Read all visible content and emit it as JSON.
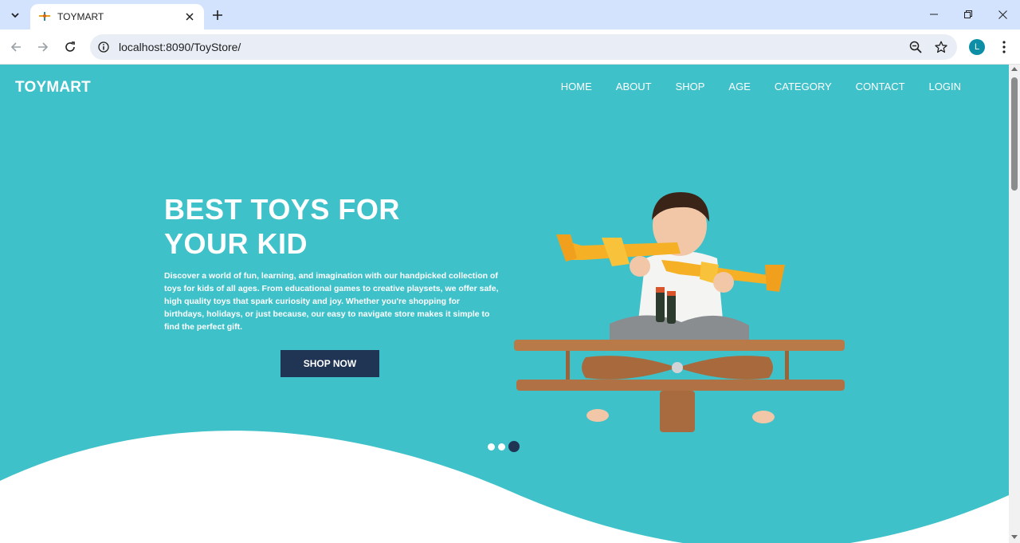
{
  "browser": {
    "tab_title": "TOYMART",
    "url": "localhost:8090/ToyStore/",
    "profile_initial": "L",
    "icons": {
      "tab_search": "chevron-down-icon",
      "favicon": "toy-plane-icon",
      "close_tab": "close-icon",
      "new_tab": "plus-icon",
      "back": "arrow-left-icon",
      "forward": "arrow-right-icon",
      "reload": "reload-icon",
      "site_info": "info-icon",
      "zoom": "zoom-icon",
      "bookmark": "star-icon",
      "menu": "kebab-icon",
      "minimize": "minimize-icon",
      "restore": "restore-icon",
      "close_window": "close-icon"
    },
    "colors": {
      "tab_strip": "#d3e3fd",
      "omnibox": "#e9eef6",
      "profile": "#0b8ea6"
    }
  },
  "site": {
    "brand": "TOYMART",
    "nav": [
      {
        "label": "HOME"
      },
      {
        "label": "ABOUT"
      },
      {
        "label": "SHOP"
      },
      {
        "label": "AGE"
      },
      {
        "label": "CATEGORY"
      },
      {
        "label": "CONTACT"
      },
      {
        "label": "LOGIN"
      }
    ],
    "hero": {
      "title_line1": "BEST TOYS FOR",
      "title_line2": "YOUR KID",
      "description": "Discover a world of fun, learning, and imagination with our handpicked collection of toys for kids of all ages. From educational games to creative playsets, we offer safe, high quality toys that spark curiosity and joy. Whether you're shopping for birthdays, holidays, or just because, our easy to navigate store makes it simple to find the perfect gift.",
      "cta_label": "SHOP NOW",
      "image": "child-with-toy-planes-image",
      "carousel": {
        "slides": 3,
        "active_index": 3
      }
    },
    "colors": {
      "hero_bg": "#3fc1c9",
      "button_bg": "#1f3553",
      "text": "#ffffff"
    }
  }
}
